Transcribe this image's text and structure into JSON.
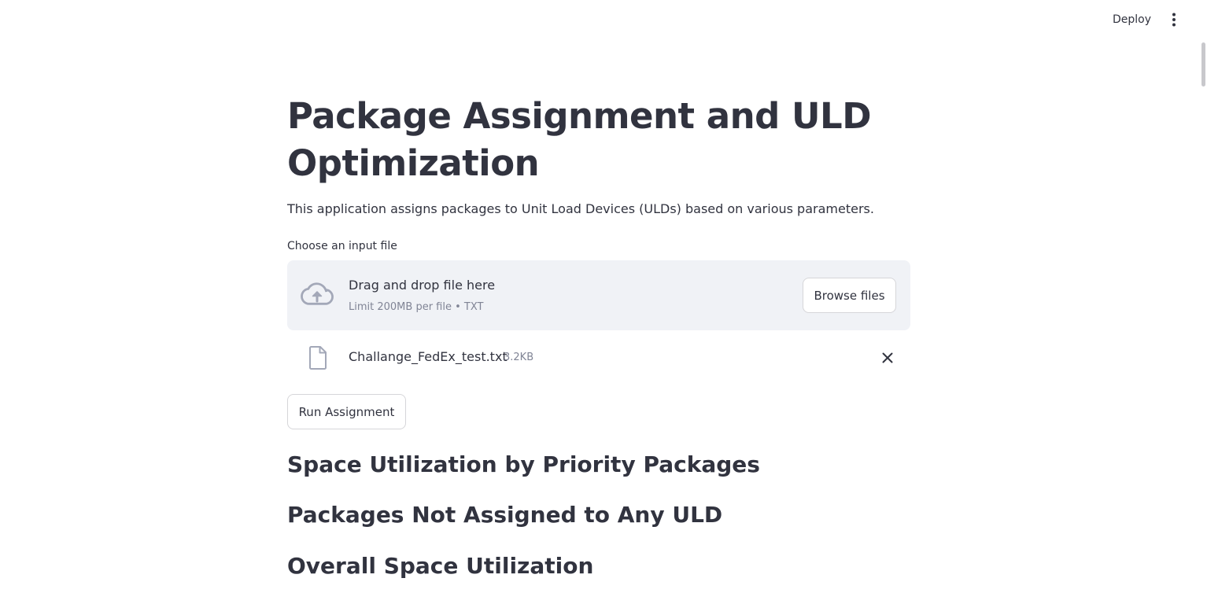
{
  "header": {
    "deploy_label": "Deploy",
    "menu_icon": "vertical-ellipsis-icon"
  },
  "main": {
    "title": "Package Assignment and ULD Optimization",
    "description": "This application assigns packages to Unit Load Devices (ULDs) based on various parameters.",
    "uploader": {
      "label": "Choose an input file",
      "drop_text": "Drag and drop file here",
      "limit_text": "Limit 200MB per file • TXT",
      "browse_label": "Browse files",
      "icon": "cloud-upload-icon"
    },
    "uploaded_file": {
      "name": "Challange_FedEx_test.txt",
      "size": "3.2KB",
      "icon": "file-icon",
      "remove_icon": "close-icon"
    },
    "run_button_label": "Run Assignment",
    "sections": {
      "priority": "Space Utilization by Priority Packages",
      "unassigned": "Packages Not Assigned to Any ULD",
      "overall": "Overall Space Utilization"
    }
  },
  "colors": {
    "text": "#31333f",
    "muted": "#808495",
    "dropzone_bg": "#f0f2f6",
    "icon": "#a3a8b8",
    "border": "#d6d6d9"
  }
}
